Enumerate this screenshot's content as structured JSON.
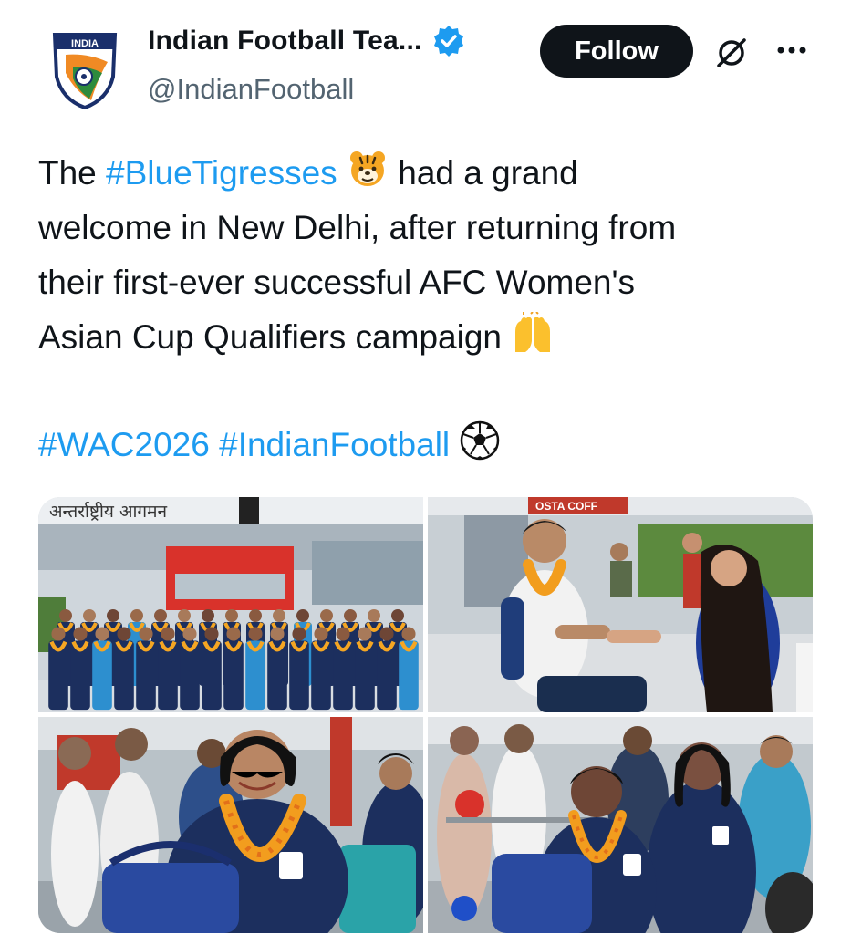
{
  "account": {
    "display_name": "Indian Football Tea...",
    "handle": "@IndianFootball",
    "verified_icon": "verified-badge-icon",
    "avatar_logo_text": "INDIA"
  },
  "actions": {
    "follow_label": "Follow"
  },
  "tweet": {
    "line1_pre": "The ",
    "hashtag1": "#BlueTigresses",
    "line1_post": " had a grand",
    "line2": "welcome in New Delhi, after returning from",
    "line3": "their first-ever successful AFC Women's",
    "line4": "Asian Cup Qualifiers campaign",
    "hashtag2": "#WAC2026",
    "hashtag3": "#IndianFootball",
    "emoji1": "tiger-face-emoji",
    "emoji2": "raising-hands-emoji",
    "emoji3": "soccer-ball-emoji"
  },
  "media": {
    "photo1_sign": "अन्तर्राष्ट्रीय आगमन",
    "photo2_sign": "OSTA COFF"
  },
  "colors": {
    "link": "#1d9bf0",
    "text": "#0f1419",
    "secondary": "#536471",
    "button_bg": "#0f1419",
    "jersey": "#1c2f5e",
    "garland": "#f5a623"
  }
}
